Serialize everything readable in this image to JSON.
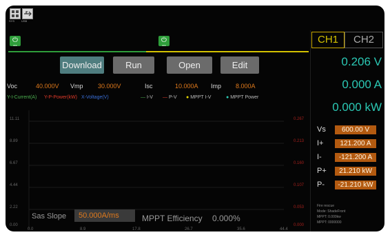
{
  "toolbar": {
    "icon1_label": "SYS",
    "icon2_label": "USB"
  },
  "power": {
    "left_label": "OFF",
    "right_label": "OFF"
  },
  "buttons": {
    "download": "Download",
    "run": "Run",
    "open": "Open",
    "edit": "Edit"
  },
  "params": {
    "voc_label": "Voc",
    "voc_value": "40.000V",
    "vmp_label": "Vmp",
    "vmp_value": "30.000V",
    "isc_label": "Isc",
    "isc_value": "10.000A",
    "imp_label": "Imp",
    "imp_value": "8.000A"
  },
  "legend": {
    "current_axis": "Y-I-Current(A)",
    "power_axis": "Y-P-Power(kW)",
    "voltage_axis": "X-Voltage(V)",
    "iv": "I-V",
    "pv": "P-V",
    "mppt_iv": "MPPT I-V",
    "mppt_power": "MPPT Power"
  },
  "chart": {
    "y_left": [
      "11.11",
      "8.89",
      "6.67",
      "4.44",
      "2.22",
      "0.00"
    ],
    "y_right": [
      "0.267",
      "0.213",
      "0.160",
      "0.107",
      "0.053",
      "0.000"
    ],
    "x": [
      "0.0",
      "8.9",
      "17.8",
      "26.7",
      "35.6",
      "44.4"
    ]
  },
  "bottom": {
    "slope_label": "Sas Slope",
    "slope_value": "50.000A/ms",
    "efficiency_label": "MPPT Efficiency",
    "efficiency_value": "0.000%"
  },
  "channels": {
    "ch1": "CH1",
    "ch2": "CH2"
  },
  "readouts": {
    "voltage": "0.206 V",
    "current": "0.000 A",
    "power": "0.000 kW"
  },
  "settings": {
    "vs_label": "Vs",
    "vs_value": "600.00 V",
    "iplus_label": "I+",
    "iplus_value": "121.200 A",
    "iminus_label": "I-",
    "iminus_value": "-121.200 A",
    "pplus_label": "P+",
    "pplus_value": "21.210 kW",
    "pminus_label": "P-",
    "pminus_value": "-21.210 kW"
  },
  "info": {
    "line1": "Fire rescue",
    "line2": "Mode: ShadeFront",
    "line3": "MPPT: 0.000kw",
    "line4": "MPPT: 0000000"
  },
  "colors": {
    "accent_green": "#2e9e3a",
    "accent_orange": "#e07a1c",
    "teal": "#2bc8b4",
    "yellow_line": "#d4c200",
    "channel_yellow": "#c9a800"
  }
}
